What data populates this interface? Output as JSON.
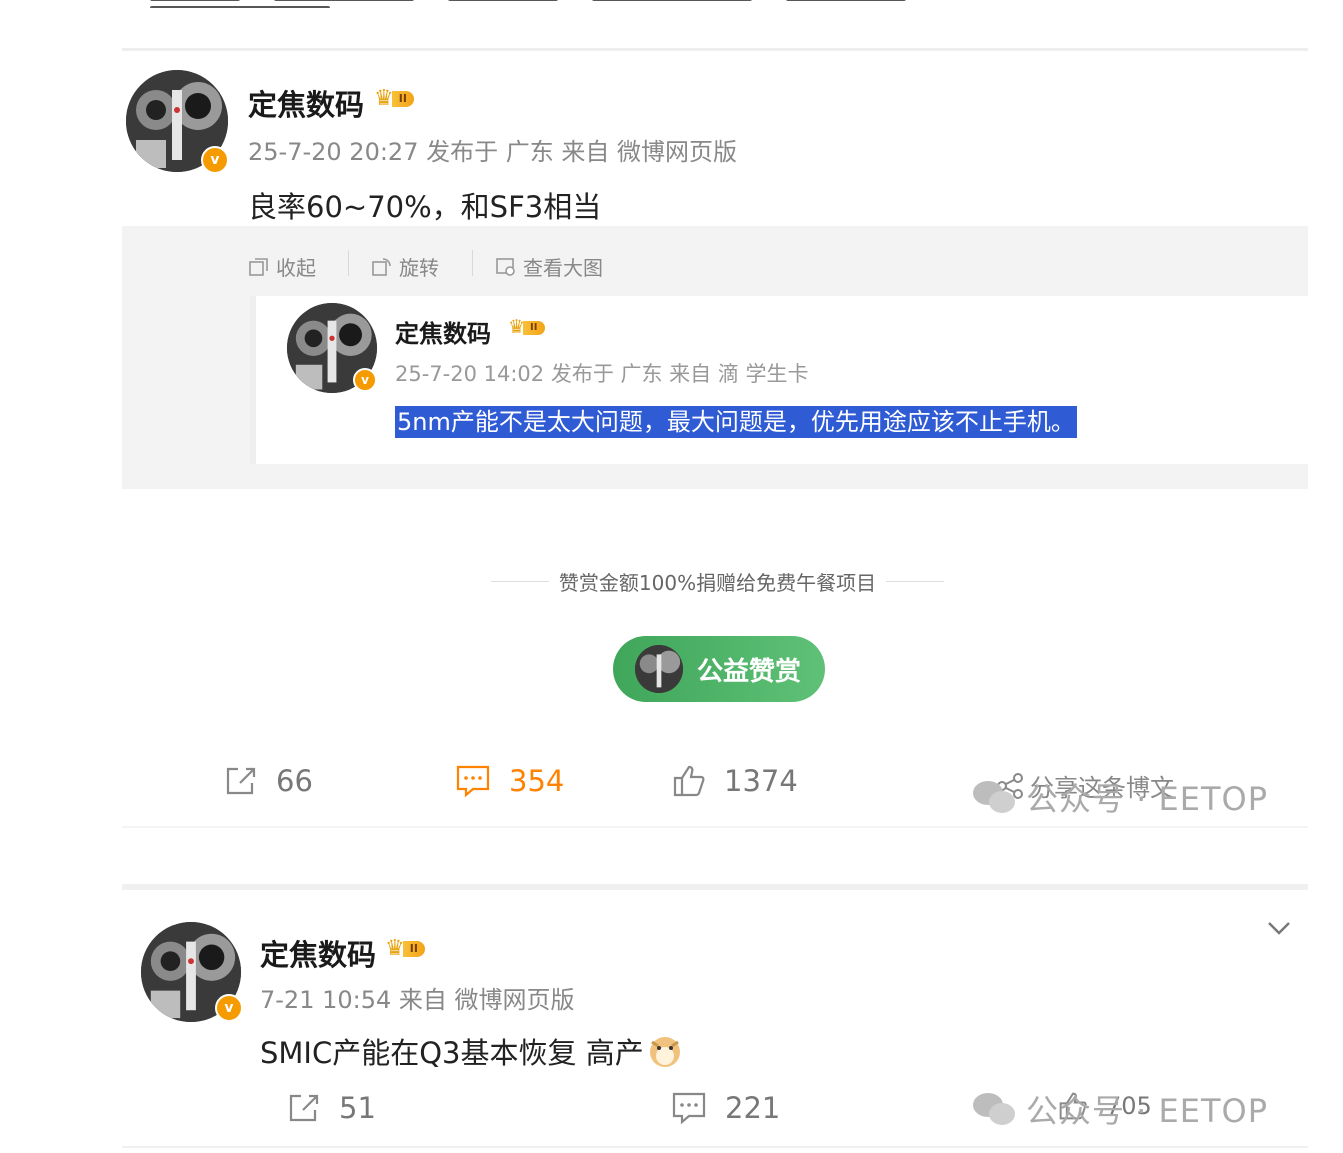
{
  "posts": [
    {
      "author": "定焦数码",
      "vip_level": "II",
      "meta": "25-7-20 20:27 发布于 广东 来自 微博网页版",
      "content": "良率60~70%，和SF3相当",
      "toolbar": [
        "收起",
        "旋转",
        "查看大图"
      ],
      "quoted": {
        "author": "定焦数码",
        "vip_level": "II",
        "meta": "25-7-20 14:02 发布于 广东 来自 滴 学生卡",
        "content": "5nm产能不是太大问题，最大问题是，优先用途应该不止手机。"
      },
      "reward_note": "赞赏金额100%捐赠给免费午餐项目",
      "reward_button": "公益赞赏",
      "actions": {
        "reposts": "66",
        "comments": "354",
        "likes": "1374"
      },
      "share_label": "分享这条博文",
      "watermark": "公众号 · EETOP"
    },
    {
      "author": "定焦数码",
      "vip_level": "II",
      "meta": "7-21 10:54 来自 微博网页版",
      "content": "SMIC产能在Q3基本恢复 高产",
      "actions": {
        "reposts": "51",
        "comments": "221",
        "likes": "705"
      },
      "watermark": "公众号 · EETOP"
    }
  ],
  "icons": {
    "verified": "verified-v-badge-icon",
    "vip": "crown-vip-icon",
    "emoji": "doge-emoji-icon"
  },
  "colors": {
    "accent_orange": "#ff8200",
    "highlight_blue": "#2f5bd4",
    "reward_green": "#4cb366",
    "verified_orange": "#f59b00"
  }
}
